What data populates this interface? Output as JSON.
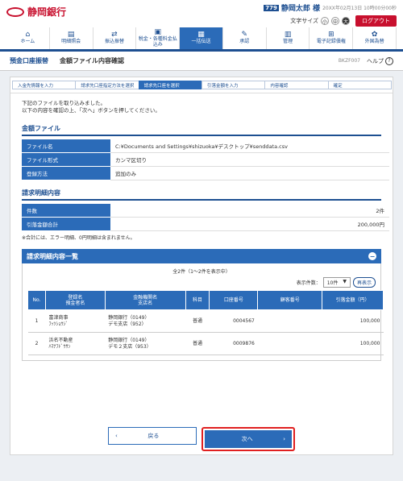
{
  "header": {
    "bank_name": "静岡銀行",
    "user_id": "779",
    "user_name": "静岡太郎 様",
    "last_login": "20XX年02月13日 10時00分00秒",
    "font_size_label": "文字サイズ",
    "font_sizes": [
      "小",
      "中",
      "大"
    ],
    "logout": "ログアウト"
  },
  "nav": [
    {
      "label": "ホーム",
      "icon": "home-icon",
      "glyph": "⌂"
    },
    {
      "label": "明細照会",
      "icon": "document-icon",
      "glyph": "▤"
    },
    {
      "label": "振込振替",
      "icon": "transfer-icon",
      "glyph": "⇄"
    },
    {
      "label": "税金・各種料金払込み",
      "icon": "tax-icon",
      "glyph": "▣"
    },
    {
      "label": "一括伝送",
      "icon": "batch-icon",
      "glyph": "▦"
    },
    {
      "label": "承認",
      "icon": "approve-icon",
      "glyph": "✎"
    },
    {
      "label": "管理",
      "icon": "admin-icon",
      "glyph": "▥"
    },
    {
      "label": "電子記録債権",
      "icon": "e-record-icon",
      "glyph": "⊞"
    },
    {
      "label": "外国為替",
      "icon": "forex-icon",
      "glyph": "✿"
    }
  ],
  "page": {
    "category": "預金口座振替",
    "title": "金額ファイル内容確認",
    "code": "BKZF007",
    "help": "ヘルプ"
  },
  "steps": [
    "入金先情報を入力",
    "請求先口座指定方法を選択",
    "請求先口座を選択",
    "引落金額を入力",
    "内容確認",
    "確定"
  ],
  "intro": [
    "下記のファイルを取り込みました。",
    "以下の内容を確認の上、「次へ」ボタンを押してください。"
  ],
  "file_section": {
    "title": "金額ファイル",
    "rows": [
      {
        "label": "ファイル名",
        "value": "C:¥Documents and Settings¥shizuoka¥デスクトップ¥senddata.csv"
      },
      {
        "label": "ファイル形式",
        "value": "カンマ区切り"
      },
      {
        "label": "登録方法",
        "value": "追加のみ"
      }
    ]
  },
  "summary_section": {
    "title": "請求明細内容",
    "rows": [
      {
        "label": "件数",
        "value": "2件"
      },
      {
        "label": "引落金額合計",
        "value": "200,000円"
      }
    ],
    "note": "※合計には、エラー明細、0円明細は含まれません。"
  },
  "list_section": {
    "title": "請求明細内容一覧",
    "count_text": "全2件（1～2件を表示中）",
    "per_page_label": "表示件数：",
    "per_page_value": "10件",
    "redraw": "再表示",
    "headers": [
      "No.",
      "登録名\n預金者名",
      "金融機関名\n支店名",
      "科目",
      "口座番号",
      "顧客番号",
      "引落金額（円）"
    ],
    "rows": [
      {
        "no": "1",
        "name1": "富津商事",
        "name2": "ﾌｯﾂｼｮｳｼﾞ",
        "bank1": "静岡銀行（0149）",
        "bank2": "デモ支店（952）",
        "type": "普通",
        "account": "0004567",
        "customer": "",
        "amount": "100,000"
      },
      {
        "no": "2",
        "name1": "浜名不動産",
        "name2": "ﾊﾏﾅﾌﾄﾞｳｻﾝ",
        "bank1": "静岡銀行（0149）",
        "bank2": "デモ２支店（953）",
        "type": "普通",
        "account": "0009876",
        "customer": "",
        "amount": "100,000"
      }
    ]
  },
  "buttons": {
    "back": "戻る",
    "next": "次へ"
  }
}
